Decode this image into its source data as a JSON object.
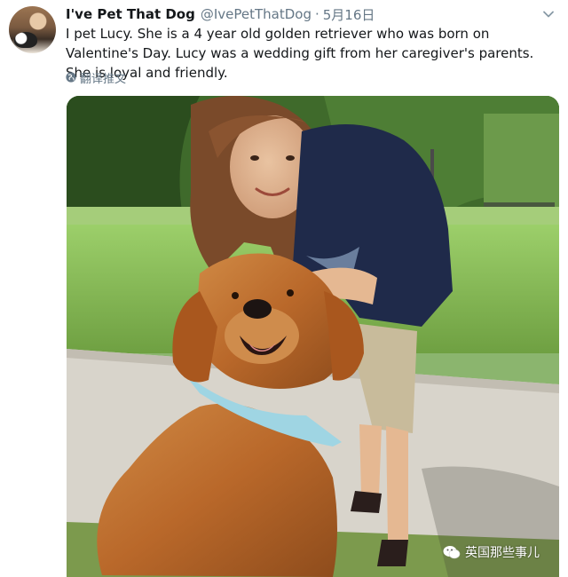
{
  "tweet": {
    "display_name": "I've Pet That Dog",
    "handle": "@IvePetThatDog",
    "separator": "·",
    "date": "5月16日",
    "text": "I pet Lucy. She is a 4 year old golden retriever who was born on Valentine's Day. Lucy was a wedding gift from her caregiver's parents. She is loyal and friendly.",
    "translate_label": "翻译推文"
  },
  "watermark": {
    "label": "英国那些事儿"
  },
  "icons": {
    "caret": "chevron-down-icon",
    "globe": "globe-icon",
    "watermark": "wechat-icon"
  },
  "colors": {
    "text": "#14171a",
    "secondary": "#657786"
  }
}
